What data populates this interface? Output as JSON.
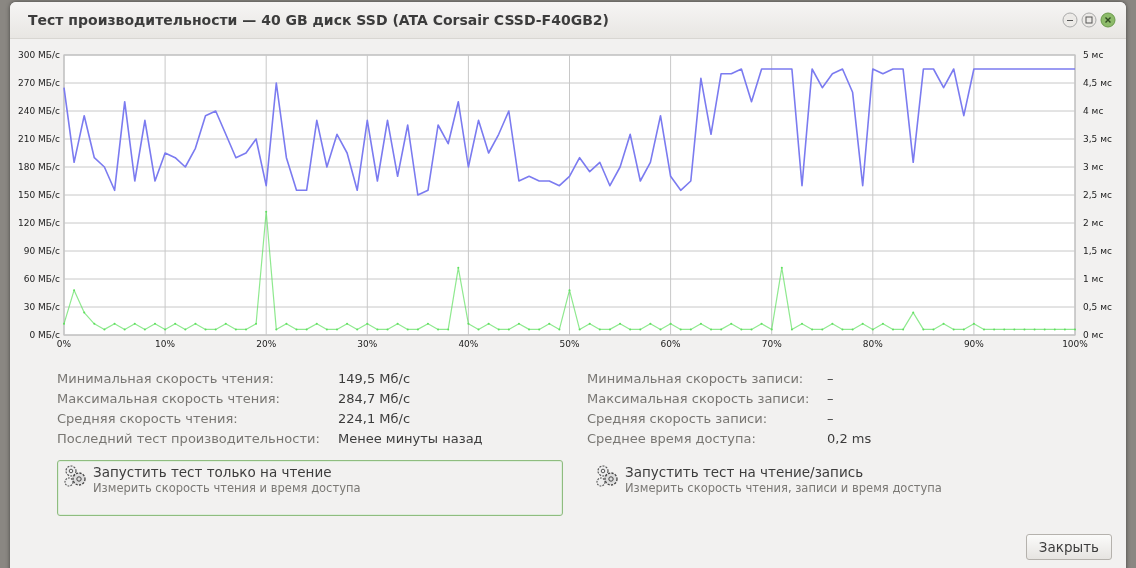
{
  "window": {
    "title": "Тест производительности — 40 GB диск SSD (ATA Corsair CSSD-F40GB2)"
  },
  "benchmark": {
    "chart_data": {
      "type": "line",
      "x": [
        0,
        1,
        2,
        3,
        4,
        5,
        6,
        7,
        8,
        9,
        10,
        11,
        12,
        13,
        14,
        15,
        16,
        17,
        18,
        19,
        20,
        21,
        22,
        23,
        24,
        25,
        26,
        27,
        28,
        29,
        30,
        31,
        32,
        33,
        34,
        35,
        36,
        37,
        38,
        39,
        40,
        41,
        42,
        43,
        44,
        45,
        46,
        47,
        48,
        49,
        50,
        51,
        52,
        53,
        54,
        55,
        56,
        57,
        58,
        59,
        60,
        61,
        62,
        63,
        64,
        65,
        66,
        67,
        68,
        69,
        70,
        71,
        72,
        73,
        74,
        75,
        76,
        77,
        78,
        79,
        80,
        81,
        82,
        83,
        84,
        85,
        86,
        87,
        88,
        89,
        90,
        91,
        92,
        93,
        94,
        95,
        96,
        97,
        98,
        99,
        100
      ],
      "series": [
        {
          "color": "#7b7bf0",
          "values": [
            265,
            185,
            235,
            190,
            180,
            155,
            250,
            165,
            230,
            165,
            195,
            190,
            180,
            200,
            235,
            240,
            215,
            190,
            195,
            210,
            160,
            270,
            190,
            155,
            155,
            230,
            180,
            215,
            195,
            155,
            230,
            165,
            230,
            170,
            225,
            150,
            155,
            225,
            205,
            250,
            180,
            230,
            195,
            215,
            240,
            165,
            170,
            165,
            165,
            160,
            170,
            190,
            175,
            185,
            160,
            180,
            215,
            165,
            185,
            235,
            170,
            155,
            165,
            275,
            215,
            280,
            280,
            285,
            250,
            285,
            285,
            285,
            285,
            160,
            285,
            265,
            280,
            285,
            260,
            160,
            285,
            280,
            285,
            285,
            185,
            285,
            285,
            265,
            285,
            235,
            285,
            285,
            285,
            285,
            285,
            285,
            285,
            285,
            285,
            285,
            285
          ]
        },
        {
          "color": "#5fe05f",
          "axis": "y2",
          "values": [
            0.2,
            0.8,
            0.4,
            0.2,
            0.1,
            0.2,
            0.1,
            0.2,
            0.1,
            0.2,
            0.1,
            0.2,
            0.1,
            0.2,
            0.1,
            0.1,
            0.2,
            0.1,
            0.1,
            0.2,
            2.2,
            0.1,
            0.2,
            0.1,
            0.1,
            0.2,
            0.1,
            0.1,
            0.2,
            0.1,
            0.2,
            0.1,
            0.1,
            0.2,
            0.1,
            0.1,
            0.2,
            0.1,
            0.1,
            1.2,
            0.2,
            0.1,
            0.2,
            0.1,
            0.1,
            0.2,
            0.1,
            0.1,
            0.2,
            0.1,
            0.8,
            0.1,
            0.2,
            0.1,
            0.1,
            0.2,
            0.1,
            0.1,
            0.2,
            0.1,
            0.2,
            0.1,
            0.1,
            0.2,
            0.1,
            0.1,
            0.2,
            0.1,
            0.1,
            0.2,
            0.1,
            1.2,
            0.1,
            0.2,
            0.1,
            0.1,
            0.2,
            0.1,
            0.1,
            0.2,
            0.1,
            0.2,
            0.1,
            0.1,
            0.4,
            0.1,
            0.1,
            0.2,
            0.1,
            0.1,
            0.2,
            0.1,
            0.1,
            0.1,
            0.1,
            0.1,
            0.1,
            0.1,
            0.1,
            0.1,
            0.1
          ]
        }
      ],
      "grid": true,
      "xlim": [
        0,
        100
      ],
      "ylim": [
        0,
        300
      ],
      "xticks": [
        {
          "value": 0,
          "label": "0%"
        },
        {
          "value": 10,
          "label": "10%"
        },
        {
          "value": 20,
          "label": "20%"
        },
        {
          "value": 30,
          "label": "30%"
        },
        {
          "value": 40,
          "label": "40%"
        },
        {
          "value": 50,
          "label": "50%"
        },
        {
          "value": 60,
          "label": "60%"
        },
        {
          "value": 70,
          "label": "70%"
        },
        {
          "value": 80,
          "label": "80%"
        },
        {
          "value": 90,
          "label": "90%"
        },
        {
          "value": 100,
          "label": "100%"
        }
      ],
      "yticks": [
        {
          "value": 0,
          "label": "0 МБ/с"
        },
        {
          "value": 30,
          "label": "30 МБ/с"
        },
        {
          "value": 60,
          "label": "60 МБ/с"
        },
        {
          "value": 90,
          "label": "90 МБ/с"
        },
        {
          "value": 120,
          "label": "120 МБ/с"
        },
        {
          "value": 150,
          "label": "150 МБ/с"
        },
        {
          "value": 180,
          "label": "180 МБ/с"
        },
        {
          "value": 210,
          "label": "210 МБ/с"
        },
        {
          "value": 240,
          "label": "240 МБ/с"
        },
        {
          "value": 270,
          "label": "270 МБ/с"
        },
        {
          "value": 300,
          "label": "300 МБ/с"
        }
      ],
      "y2lim": [
        0,
        5
      ],
      "y2ticks": [
        {
          "value": 0,
          "label": "0 мс"
        },
        {
          "value": 0.5,
          "label": "0,5 мс"
        },
        {
          "value": 1,
          "label": "1 мс"
        },
        {
          "value": 1.5,
          "label": "1,5 мс"
        },
        {
          "value": 2,
          "label": "2 мс"
        },
        {
          "value": 2.5,
          "label": "2,5 мс"
        },
        {
          "value": 3,
          "label": "3 мс"
        },
        {
          "value": 3.5,
          "label": "3,5 мс"
        },
        {
          "value": 4,
          "label": "4 мс"
        },
        {
          "value": 4.5,
          "label": "4,5 мс"
        },
        {
          "value": 5,
          "label": "5 мс"
        }
      ]
    }
  },
  "stats_left": [
    {
      "label": "Минимальная скорость чтения:",
      "value": "149,5 Мб/с"
    },
    {
      "label": "Максимальная скорость чтения:",
      "value": "284,7 Мб/с"
    },
    {
      "label": "Средняя скорость чтения:",
      "value": "224,1 Мб/с"
    },
    {
      "label": "Последний тест производительности:",
      "value": "Менее минуты назад"
    }
  ],
  "stats_right": [
    {
      "label": "Минимальная скорость записи:",
      "value": "–"
    },
    {
      "label": "Максимальная скорость записи:",
      "value": "–"
    },
    {
      "label": "Средняя скорость записи:",
      "value": "–"
    },
    {
      "label": "Среднее время доступа:",
      "value": "0,2 ms"
    }
  ],
  "actions": [
    {
      "title": "Запустить тест только на чтение",
      "subtitle": "Измерить скорость чтения и время доступа",
      "selected": true
    },
    {
      "title": "Запустить тест на чтение/запись",
      "subtitle": "Измерить скорость чтения, записи и время доступа",
      "selected": false
    }
  ],
  "buttons": [
    {
      "label": "Закрыть"
    }
  ]
}
